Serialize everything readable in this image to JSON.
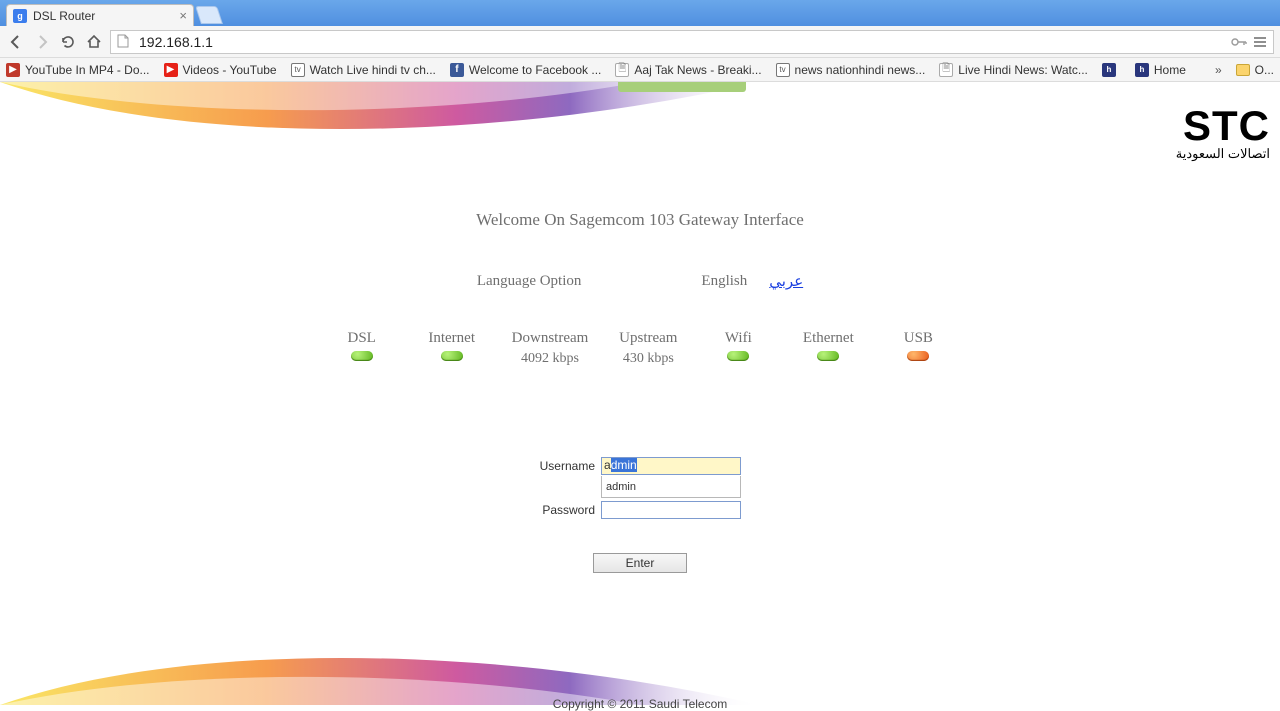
{
  "browser": {
    "tab_title": "DSL Router",
    "url": "192.168.1.1",
    "bookmarks": [
      {
        "icon": "ytmp4",
        "label": "YouTube In MP4 - Do..."
      },
      {
        "icon": "yt",
        "label": "Videos - YouTube"
      },
      {
        "icon": "tv",
        "label": "Watch Live hindi tv ch..."
      },
      {
        "icon": "fb",
        "label": "Welcome to Facebook ..."
      },
      {
        "icon": "doc",
        "label": "Aaj Tak News - Breaki..."
      },
      {
        "icon": "tv",
        "label": "news nationhindi news..."
      },
      {
        "icon": "doc",
        "label": "Live Hindi News: Watc..."
      },
      {
        "icon": "hn",
        "label": ""
      },
      {
        "icon": "hn",
        "label": "Home"
      }
    ],
    "overflow": "»",
    "other_bookmarks": "O..."
  },
  "page": {
    "logo_main": "STC",
    "logo_ar": "اتصالات السعودية",
    "welcome": "Welcome On Sagemcom 103 Gateway Interface",
    "language_label": "Language Option",
    "lang_en": "English",
    "lang_ar": "عربي",
    "status": [
      {
        "label": "DSL",
        "value": "",
        "led": "green"
      },
      {
        "label": "Internet",
        "value": "",
        "led": "green"
      },
      {
        "label": "Downstream",
        "value": "4092 kbps",
        "led": ""
      },
      {
        "label": "Upstream",
        "value": "430 kbps",
        "led": ""
      },
      {
        "label": "Wifi",
        "value": "",
        "led": "green"
      },
      {
        "label": "Ethernet",
        "value": "",
        "led": "green"
      },
      {
        "label": "USB",
        "value": "",
        "led": "orange"
      }
    ],
    "form": {
      "username_label": "Username",
      "password_label": "Password",
      "username_prefix": "a",
      "username_selected": "dmin",
      "autofill": "admin",
      "enter": "Enter"
    },
    "copyright": "Copyright © 2011 Saudi Telecom"
  }
}
